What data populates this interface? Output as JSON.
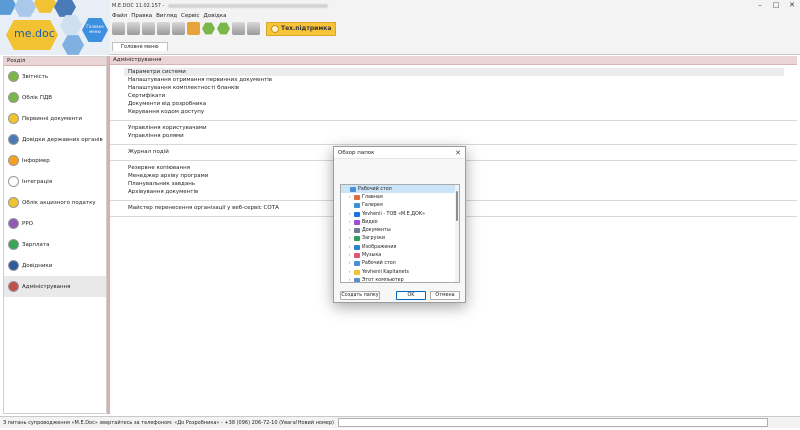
{
  "app": {
    "title": "M.E.DOC 11.02.157 -",
    "logo_text": "me.doc",
    "logo_badge": "Головне меню"
  },
  "menu": [
    "Файл",
    "Правка",
    "Вигляд",
    "Сервіс",
    "Довідка"
  ],
  "toolbar": {
    "support_label": "Тех.підтримка"
  },
  "tabs": [
    {
      "label": "Головне меню"
    }
  ],
  "sidebar": {
    "header": "Розділ",
    "items": [
      {
        "label": "Звітність",
        "icon": "reports-icon",
        "color": "#7ab648"
      },
      {
        "label": "Облік ПДВ",
        "icon": "vat-icon",
        "color": "#7ab648"
      },
      {
        "label": "Первинні документи",
        "icon": "documents-icon",
        "color": "#f1c232"
      },
      {
        "label": "Довідки державних органів",
        "icon": "gov-icon",
        "color": "#4a7bb7"
      },
      {
        "label": "Інформер",
        "icon": "informer-icon",
        "color": "#f4a020"
      },
      {
        "label": "Інтеграція",
        "icon": "integration-icon",
        "color": "#ffffff"
      },
      {
        "label": "Облік акцизного податку",
        "icon": "excise-icon",
        "color": "#f1c232"
      },
      {
        "label": "РРО",
        "icon": "rro-icon",
        "color": "#8e5ab5"
      },
      {
        "label": "Зарплата",
        "icon": "salary-icon",
        "color": "#3aa655"
      },
      {
        "label": "Довідники",
        "icon": "directories-icon",
        "color": "#2f5aa0"
      },
      {
        "label": "Адміністрування",
        "icon": "admin-icon",
        "color": "#c0504d"
      }
    ]
  },
  "main": {
    "header": "Адміністрування",
    "groups": [
      [
        "Параметри системи",
        "Налаштування отримання первинних документів",
        "Налаштування комплектності бланків",
        "Сертифікати",
        "Документи від розробника",
        "Керування кодом доступу"
      ],
      [
        "Управління користувачами",
        "Управління ролями"
      ],
      [
        "Журнал подій"
      ],
      [
        "Резервне копіювання",
        "Менеджер архіву програми",
        "Планувальник завдань",
        "Архівування документів"
      ],
      [
        "Майстер перенесення організації у веб-сервіс СОТА"
      ]
    ]
  },
  "status": {
    "text": "З питань супроводження «M.E.Doc» звертайтесь за телефоном: «До Розробника» - +38 (096) 206-72-10 (Увага!Новий номер)"
  },
  "dialog": {
    "title": "Обзор папок",
    "tree": [
      {
        "label": "Рабочий стол",
        "color": "#4a90d9",
        "arrow": "",
        "indent": 0,
        "selected": true
      },
      {
        "label": "Главная",
        "color": "#e06b3b",
        "arrow": "›",
        "indent": 1
      },
      {
        "label": "Галерея",
        "color": "#3a8fd8",
        "arrow": "",
        "indent": 1
      },
      {
        "label": "Yevhenii - ТОВ «М.Е.ДОК»",
        "color": "#1a73e8",
        "arrow": "›",
        "indent": 1
      },
      {
        "label": "Видео",
        "color": "#9b4fd0",
        "arrow": "›",
        "indent": 1
      },
      {
        "label": "Документы",
        "color": "#6b7d8e",
        "arrow": "›",
        "indent": 1
      },
      {
        "label": "Загрузки",
        "color": "#2f9e5f",
        "arrow": "›",
        "indent": 1
      },
      {
        "label": "Изображения",
        "color": "#2e7fd6",
        "arrow": "›",
        "indent": 1
      },
      {
        "label": "Музыка",
        "color": "#e0567a",
        "arrow": "›",
        "indent": 1
      },
      {
        "label": "Рабочий стол",
        "color": "#4a90d9",
        "arrow": "›",
        "indent": 1
      },
      {
        "label": "Yevhenii Kapitanets",
        "color": "#f1c232",
        "arrow": "›",
        "indent": 1
      },
      {
        "label": "Этот компьютер",
        "color": "#5b8fc7",
        "arrow": "›",
        "indent": 1
      }
    ],
    "buttons": {
      "create": "Создать папку",
      "ok": "OK",
      "cancel": "Отмена"
    }
  }
}
